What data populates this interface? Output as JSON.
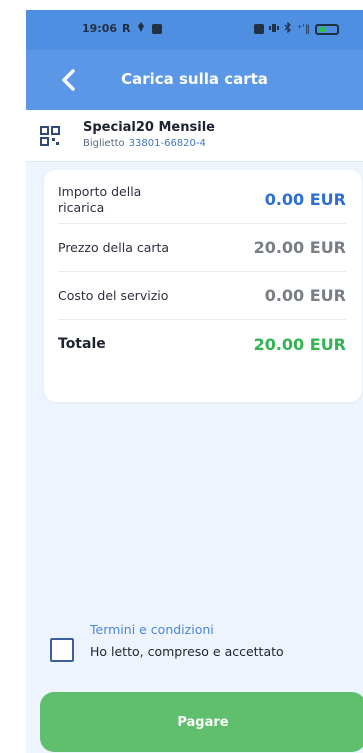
{
  "status_bar": {
    "time": "19:06",
    "left_icons": [
      "R",
      "pin",
      "linkedin"
    ],
    "right_icons": [
      "nfc",
      "vibrate",
      "bluetooth",
      "signal",
      "battery"
    ],
    "signal_text": "⁺ʹ‖"
  },
  "header": {
    "title": "Carica sulla carta",
    "back_icon": "chevron-left-icon"
  },
  "ticket": {
    "name": "Special20 Mensile",
    "label": "Biglietto",
    "number": "33801-66820-4",
    "icon": "qr-code-icon"
  },
  "summary": {
    "rows": [
      {
        "label": "Importo della ricarica",
        "value": "0.00 EUR",
        "color": "#2e6fd6"
      },
      {
        "label": "Prezzo della carta",
        "value": "20.00 EUR",
        "color": "#7a7f86"
      },
      {
        "label": "Costo del servizio",
        "value": "0.00 EUR",
        "color": "#7a7f86"
      },
      {
        "label": "Totale",
        "value": "20.00 EUR",
        "color": "#31b451"
      }
    ]
  },
  "terms": {
    "link_text": "Termini e condizioni",
    "accept_text": "Ho letto, compreso e accettato",
    "checked": false
  },
  "actions": {
    "pay_label": "Pagare"
  },
  "colors": {
    "appbar": "#5a97e6",
    "background": "#eef4fd",
    "pay_button": "#5fbf6c"
  }
}
